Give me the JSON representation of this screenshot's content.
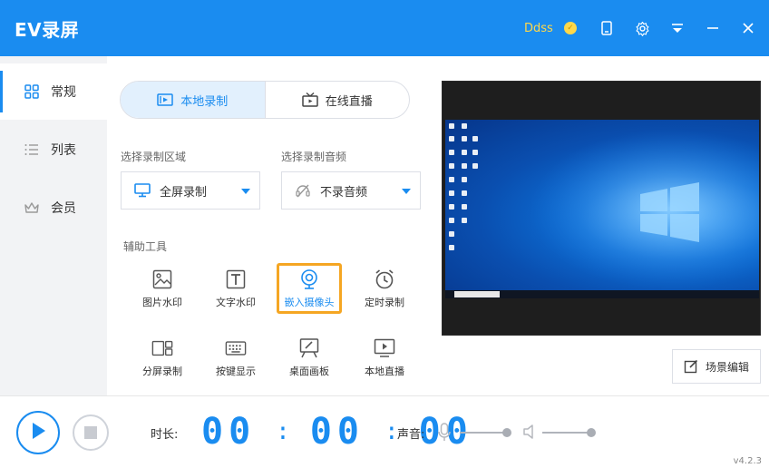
{
  "app": {
    "title": "EV录屏",
    "version": "v4.2.3"
  },
  "titlebar": {
    "user_name": "Ddss",
    "icons": [
      "coin-icon",
      "phone-icon",
      "gear-icon",
      "menu-icon",
      "minimize-icon",
      "close-icon"
    ],
    "accent": "#1a8cf0"
  },
  "sidebar": {
    "items": [
      {
        "label": "常规",
        "icon": "grid-icon",
        "active": true
      },
      {
        "label": "列表",
        "icon": "list-icon",
        "active": false
      },
      {
        "label": "会员",
        "icon": "crown-icon",
        "active": false
      }
    ]
  },
  "mode_tabs": [
    {
      "label": "本地录制",
      "icon": "record-icon",
      "active": true
    },
    {
      "label": "在线直播",
      "icon": "tv-icon",
      "active": false
    }
  ],
  "record_area": {
    "label": "选择录制区域",
    "value": "全屏录制",
    "icon": "monitor-icon"
  },
  "record_audio": {
    "label": "选择录制音频",
    "value": "不录音频",
    "icon": "mute-icon"
  },
  "tools": {
    "label": "辅助工具",
    "items": [
      {
        "label": "图片水印",
        "icon": "image-icon"
      },
      {
        "label": "文字水印",
        "icon": "text-icon"
      },
      {
        "label": "嵌入摄像头",
        "icon": "webcam-icon",
        "selected": true
      },
      {
        "label": "定时录制",
        "icon": "alarm-icon"
      },
      {
        "label": "分屏录制",
        "icon": "split-screen-icon"
      },
      {
        "label": "按键显示",
        "icon": "keyboard-icon"
      },
      {
        "label": "桌面画板",
        "icon": "easel-icon"
      },
      {
        "label": "本地直播",
        "icon": "play-screen-icon"
      }
    ]
  },
  "preview": {
    "scene_button": "场景编辑"
  },
  "bottom": {
    "duration_label": "时长:",
    "time": {
      "hh": "00",
      "mm": "00",
      "ss": "00"
    },
    "sound_label": "声音:",
    "mic_level": 1.0,
    "speaker_level": 1.0
  }
}
